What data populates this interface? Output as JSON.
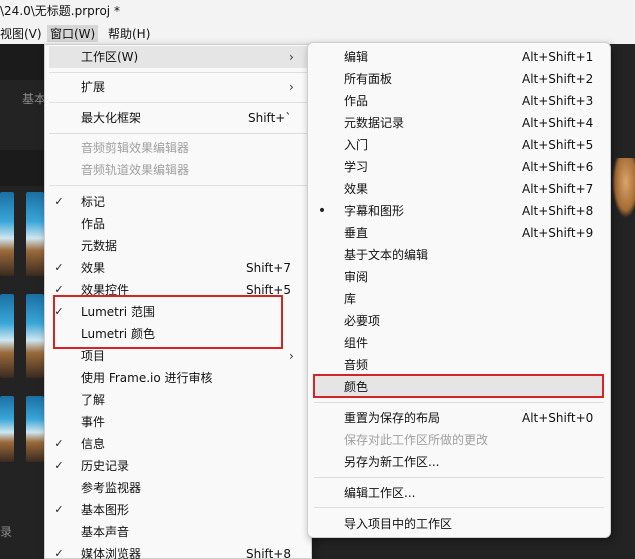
{
  "window": {
    "title": "\\24.0\\无标题.prproj *"
  },
  "menubar": {
    "view": "视图(V)",
    "window": "窗口(W)",
    "help": "帮助(H)"
  },
  "background": {
    "panel_tab": "基本",
    "panel_tab_bottom": "录"
  },
  "window_menu": {
    "items": [
      {
        "label": "工作区(W)",
        "shortcut": "",
        "checked": false,
        "submenu": true
      },
      {
        "label": "扩展",
        "shortcut": "",
        "checked": false,
        "submenu": true
      },
      {
        "label": "最大化框架",
        "shortcut": "Shift+`",
        "checked": false
      },
      {
        "label": "音频剪辑效果编辑器",
        "shortcut": "",
        "disabled": true
      },
      {
        "label": "音频轨道效果编辑器",
        "shortcut": "",
        "disabled": true
      },
      {
        "label": "标记",
        "shortcut": "",
        "checked": true
      },
      {
        "label": "作品",
        "shortcut": "",
        "checked": false
      },
      {
        "label": "元数据",
        "shortcut": "",
        "checked": false
      },
      {
        "label": "效果",
        "shortcut": "Shift+7",
        "checked": true
      },
      {
        "label": "效果控件",
        "shortcut": "Shift+5",
        "checked": true
      },
      {
        "label": "Lumetri 范围",
        "shortcut": "",
        "checked": true
      },
      {
        "label": "Lumetri 颜色",
        "shortcut": "",
        "checked": false
      },
      {
        "label": "项目",
        "shortcut": "",
        "checked": false,
        "submenu": true
      },
      {
        "label": "使用 Frame.io 进行审核",
        "shortcut": "",
        "checked": false
      },
      {
        "label": "了解",
        "shortcut": "",
        "checked": false
      },
      {
        "label": "事件",
        "shortcut": "",
        "checked": false
      },
      {
        "label": "信息",
        "shortcut": "",
        "checked": true
      },
      {
        "label": "历史记录",
        "shortcut": "",
        "checked": true
      },
      {
        "label": "参考监视器",
        "shortcut": "",
        "checked": false
      },
      {
        "label": "基本图形",
        "shortcut": "",
        "checked": true
      },
      {
        "label": "基本声音",
        "shortcut": "",
        "checked": false
      },
      {
        "label": "媒体浏览器",
        "shortcut": "Shift+8",
        "checked": true
      }
    ]
  },
  "workspace_menu": {
    "items": [
      {
        "label": "编辑",
        "shortcut": "Alt+Shift+1"
      },
      {
        "label": "所有面板",
        "shortcut": "Alt+Shift+2"
      },
      {
        "label": "作品",
        "shortcut": "Alt+Shift+3"
      },
      {
        "label": "元数据记录",
        "shortcut": "Alt+Shift+4"
      },
      {
        "label": "入门",
        "shortcut": "Alt+Shift+5"
      },
      {
        "label": "学习",
        "shortcut": "Alt+Shift+6"
      },
      {
        "label": "效果",
        "shortcut": "Alt+Shift+7"
      },
      {
        "label": "字幕和图形",
        "shortcut": "Alt+Shift+8",
        "bullet": true
      },
      {
        "label": "垂直",
        "shortcut": "Alt+Shift+9"
      },
      {
        "label": "基于文本的编辑",
        "shortcut": ""
      },
      {
        "label": "审阅",
        "shortcut": ""
      },
      {
        "label": "库",
        "shortcut": ""
      },
      {
        "label": "必要项",
        "shortcut": ""
      },
      {
        "label": "组件",
        "shortcut": ""
      },
      {
        "label": "音频",
        "shortcut": ""
      },
      {
        "label": "颜色",
        "shortcut": "",
        "highlighted": true
      },
      {
        "label": "重置为保存的布局",
        "shortcut": "Alt+Shift+0"
      },
      {
        "label": "保存对此工作区所做的更改",
        "shortcut": "",
        "disabled": true
      },
      {
        "label": "另存为新工作区...",
        "shortcut": ""
      },
      {
        "label": "编辑工作区...",
        "shortcut": ""
      },
      {
        "label": "导入项目中的工作区",
        "shortcut": ""
      }
    ]
  },
  "colors": {
    "highlight_box": "#d62424",
    "menu_bg": "#f9f9f9"
  }
}
